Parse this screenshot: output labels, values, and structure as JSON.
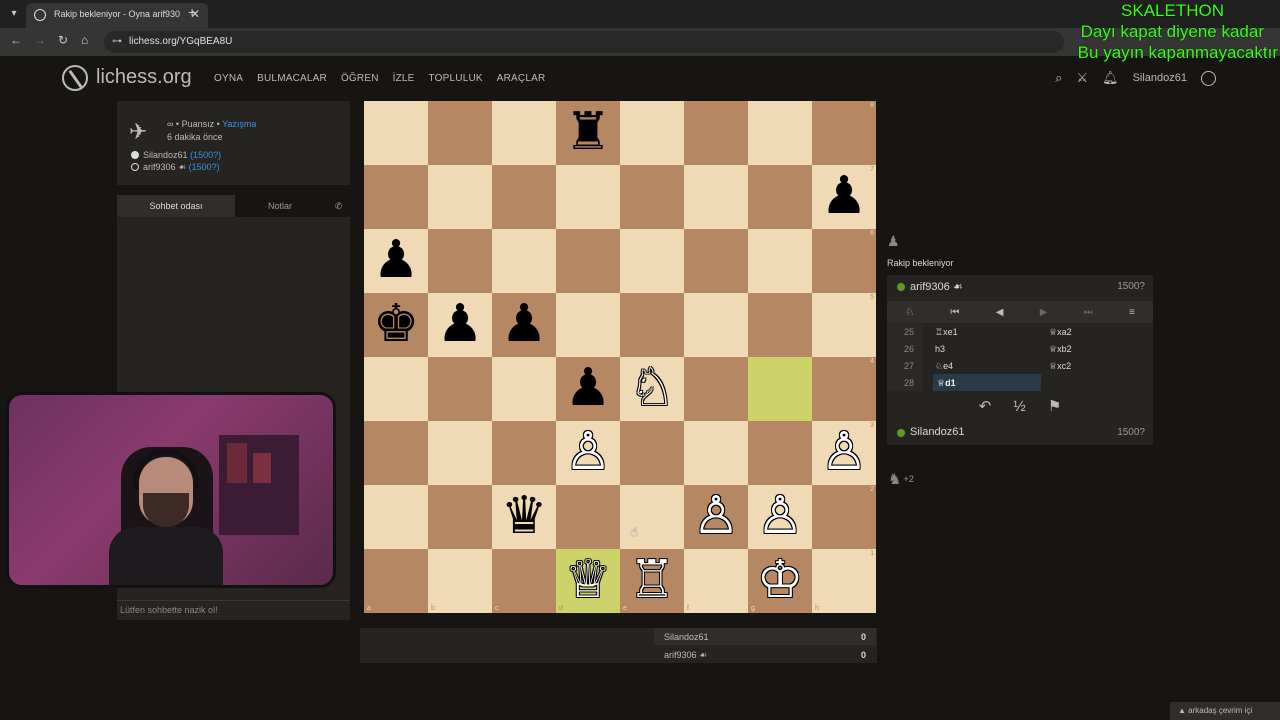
{
  "browser": {
    "tab_title": "Rakip bekleniyor - Oyna arif930",
    "url": "lichess.org/YGqBEA8U",
    "nav_back": "←",
    "nav_forward": "→",
    "nav_reload": "↻",
    "nav_home": "⌂",
    "tab_close": "✕",
    "new_tab": "+"
  },
  "overlay": {
    "line1": "SKALETHON",
    "line2": "Dayı kapat diyene kadar",
    "line3": "Bu yayın kapanmayacaktır"
  },
  "site": {
    "logo_text": "lichess.org",
    "nav": [
      "OYNA",
      "BULMACALAR",
      "ÖĞREN",
      "İZLE",
      "TOPLULUK",
      "ARAÇLAR"
    ],
    "username": "Silandoz61"
  },
  "game_info": {
    "line1_prefix": "∞ • Puansız • ",
    "line1_link": "Yazışma",
    "line2": "6 dakika önce",
    "players": [
      {
        "name": "Silandoz61",
        "rating": "(1500?)",
        "color": "white"
      },
      {
        "name": "arif9306 ☙",
        "rating": "(1500?)",
        "color": "black"
      }
    ]
  },
  "chat": {
    "tab_room": "Sohbet odası",
    "tab_notes": "Notlar",
    "placeholder": "Lütfen sohbette nazik ol!"
  },
  "board": {
    "files": [
      "a",
      "b",
      "c",
      "d",
      "e",
      "f",
      "g",
      "h"
    ],
    "ranks": [
      "8",
      "7",
      "6",
      "5",
      "4",
      "3",
      "2",
      "1"
    ],
    "pieces": [
      {
        "sq": "d8",
        "piece": "♜",
        "color": "b"
      },
      {
        "sq": "h7",
        "piece": "♟",
        "color": "b"
      },
      {
        "sq": "a6",
        "piece": "♟",
        "color": "b"
      },
      {
        "sq": "a5",
        "piece": "♚",
        "color": "b"
      },
      {
        "sq": "b5",
        "piece": "♟",
        "color": "b"
      },
      {
        "sq": "c5",
        "piece": "♟",
        "color": "b"
      },
      {
        "sq": "d4",
        "piece": "♟",
        "color": "b"
      },
      {
        "sq": "e4",
        "piece": "♘",
        "color": "w"
      },
      {
        "sq": "d3",
        "piece": "♙",
        "color": "w"
      },
      {
        "sq": "h3",
        "piece": "♙",
        "color": "w"
      },
      {
        "sq": "c2",
        "piece": "♛",
        "color": "b"
      },
      {
        "sq": "f2",
        "piece": "♙",
        "color": "w"
      },
      {
        "sq": "g2",
        "piece": "♙",
        "color": "w"
      },
      {
        "sq": "d1",
        "piece": "♕",
        "color": "w"
      },
      {
        "sq": "e1",
        "piece": "♖",
        "color": "w"
      },
      {
        "sq": "g1",
        "piece": "♔",
        "color": "w"
      }
    ],
    "highlights": [
      "g4",
      "d1"
    ]
  },
  "under_board": {
    "rows": [
      {
        "name": "Silandoz61",
        "score": "0"
      },
      {
        "name": "arif9306 ☙",
        "score": "0"
      }
    ]
  },
  "right_panel": {
    "waiting": "Rakip bekleniyor",
    "opponent": {
      "name": "arif9306 ☙",
      "rating": "1500?"
    },
    "player": {
      "name": "Silandoz61",
      "rating": "1500?"
    },
    "controls": [
      "♘",
      "⏮",
      "◀",
      "▶",
      "⏭",
      "≡"
    ],
    "moves": [
      {
        "num": "25",
        "white": "♖xe1",
        "black": "♕xa2"
      },
      {
        "num": "26",
        "white": "h3",
        "black": "♕xb2"
      },
      {
        "num": "27",
        "white": "♘e4",
        "black": "♕xc2"
      },
      {
        "num": "28",
        "white": "♕d1",
        "black": ""
      }
    ],
    "actions": [
      "↶",
      "½",
      "⚑"
    ],
    "material": "+2"
  },
  "footer": {
    "friends": "▲ arkadaş çevrim içi"
  }
}
